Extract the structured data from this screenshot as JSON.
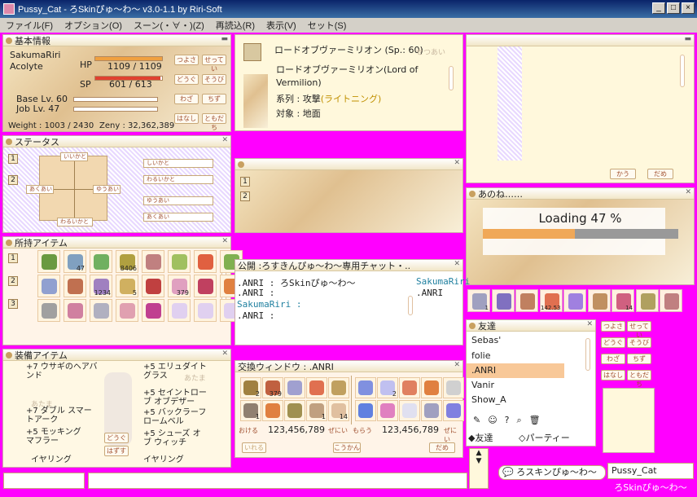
{
  "window": {
    "title": "Pussy_Cat - ろSkinぴゅ〜わ〜 v3.0-1.1 by Riri-Soft",
    "min": "_",
    "max": "□",
    "close": "×"
  },
  "menu": [
    "ファイル(F)",
    "オプション(O)",
    "スーン(・∀・)(Z)",
    "再読込(R)",
    "表示(V)",
    "セット(S)"
  ],
  "basic": {
    "title": "基本情報",
    "name": "SakumaRiri",
    "job": "Acolyte",
    "hp_label": "HP",
    "hp": "1109 / 1109",
    "hp_ratio": 1.0,
    "sp_label": "SP",
    "sp": "601 / 613",
    "sp_ratio": 0.98,
    "base": "Base Lv. 60",
    "joblv": "Job Lv. 47",
    "weight": "Weight : 1003 / 2430",
    "zeny": "Zeny : 32,362,389",
    "buttons": [
      "つよさ",
      "せってい",
      "どうぐ",
      "そうび",
      "わざ",
      "ちず",
      "はなし",
      "ともだち"
    ]
  },
  "skill": {
    "line1": "ロードオブヴァーミリオン (Sp.: 60)",
    "faint": "せつあい",
    "name": "ロードオブヴァーミリオン(Lord of",
    "name2": "Vermilion)",
    "type_label": "系列 : 攻撃",
    "type_value": "(ライトニング)",
    "target": "対象 : 地面"
  },
  "status": {
    "title": "ステータス",
    "tabs": [
      "1",
      "2"
    ],
    "grid_labels": {
      "top": "いいかと",
      "left": "あくあい",
      "right": "ゆうあい",
      "bottom": "わるいかと"
    },
    "labels": [
      "しいかと",
      "わるいかと",
      "ゆうあい",
      "あくあい"
    ]
  },
  "mid_panel": {
    "tabs": [
      "1",
      "2"
    ]
  },
  "inventory": {
    "title": "所持アイテム",
    "tabs": [
      "1",
      "2",
      "3"
    ],
    "counts": [
      "",
      "47",
      "",
      "8406",
      "",
      "",
      "",
      "",
      "",
      "",
      "1234",
      "5",
      "",
      "379",
      "",
      "",
      "",
      "",
      "",
      "",
      "",
      "",
      "",
      ""
    ],
    "colors": [
      "#6a9a40",
      "#80a0c0",
      "#70b060",
      "#b0a040",
      "#c08080",
      "#a0c060",
      "#e06040",
      "#80b050",
      "#90a0d0",
      "#c07050",
      "#a080c0",
      "#d0b060",
      "#c04040",
      "#e0a0c0",
      "#c04060",
      "#e08040",
      "#a0a0a0",
      "#d080a0",
      "#b0b0c0",
      "#e0a0b0",
      "#c04090",
      "#e0d0f0",
      "#e0d0f0",
      "#e0d0f0"
    ]
  },
  "chat": {
    "title": "公開 :ろすきんぴゅ〜わ〜専用チャット・..",
    "lines": [
      ".ANRI : ろSkinぴゅ〜わ〜",
      ".ANRI :",
      "SakumaRiri :",
      ".ANRI :"
    ],
    "side": [
      "SakumaRiri",
      ".ANRI"
    ]
  },
  "equip": {
    "title": "装備アイテム",
    "left": [
      "+7 ウサギのヘアバンド",
      "あたま",
      "+7 ダブル スマートアーク",
      "+5 モッキング マフラー",
      "イヤリング"
    ],
    "right": [
      "+5 エリュダイトグラス",
      "あたま",
      "+5 セイントローブ オブデザー",
      "+5 バックラーフロームベル",
      "+5 シューズ オブ ウィッチ",
      "イヤリング"
    ],
    "buttons": [
      "どうぐ",
      "はずす"
    ]
  },
  "trade": {
    "title": "交換ウィンドウ : .ANRI",
    "left_counts": [
      "2",
      "379",
      "",
      "",
      "",
      "1",
      "",
      "",
      "1",
      "14"
    ],
    "right_counts": [
      "",
      "2",
      "",
      "",
      "",
      "",
      "",
      "",
      "",
      ""
    ],
    "left_label": "おける",
    "left_zeny": "123,456,789",
    "left_unit": "ぜにい",
    "right_label": "もらう",
    "right_zeny": "123,456,789",
    "right_unit": "ぜにい",
    "buttons": [
      "いれる",
      "こうかん",
      "だめ"
    ]
  },
  "top_right": {
    "buttons": [
      "かう",
      "だめ"
    ]
  },
  "loading": {
    "title": "あのね……",
    "text": "Loading 47 %",
    "progress": 0.47
  },
  "hotbar": {
    "counts": [
      "1",
      "",
      "",
      "142.53",
      "",
      "",
      "14",
      ""
    ]
  },
  "friends": {
    "title": "友達",
    "list": [
      "Sebas'",
      "folie",
      ".ANRI",
      "Vanir",
      "Show_A"
    ],
    "selected": 2,
    "tab_friends": "友達",
    "tab_party": "パーティー"
  },
  "mini_buttons": [
    "つよさ",
    "せってい",
    "どうぐ",
    "そうび",
    "わざ",
    "ちず",
    "はなし",
    "ともだち"
  ],
  "bottom": {
    "chat_button": "ろスキンぴゅ〜わ〜",
    "name_box": "Pussy_Cat",
    "logo": "ろSkinぴゅ〜わ〜"
  },
  "colors": {
    "background": "#ff00ff",
    "panel": "#fff8dc",
    "accent": "#a05030"
  }
}
